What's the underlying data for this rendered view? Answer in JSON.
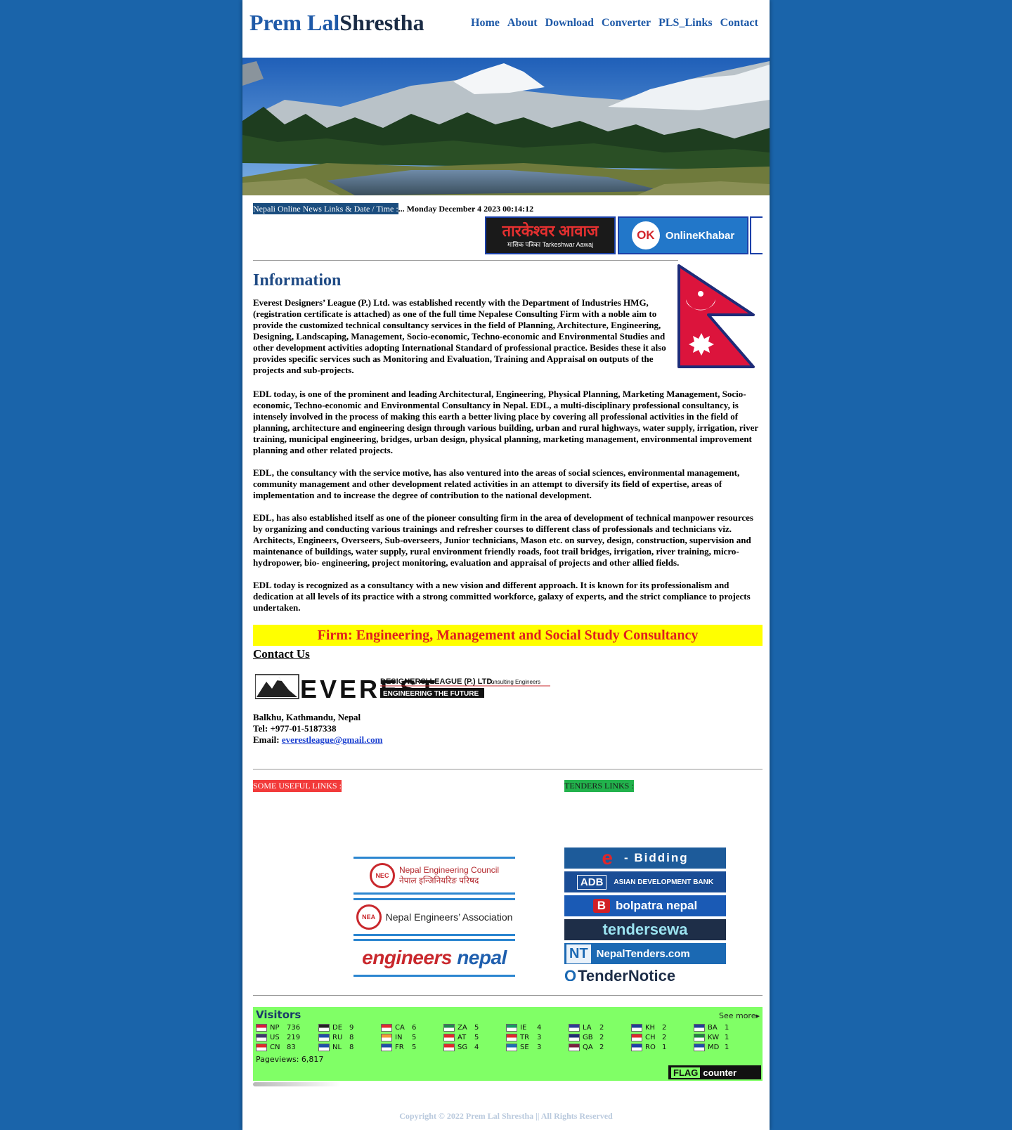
{
  "header": {
    "brand_first": "Prem Lal",
    "brand_last": "Shrestha",
    "nav": [
      "Home",
      "About",
      "Download",
      "Converter",
      "PLS_Links",
      "Contact"
    ]
  },
  "ticker": {
    "label": "Nepali Online News Links & Date / Time :",
    "datetime": "... Monday December 4 2023 00:14:12"
  },
  "news_links": [
    {
      "title": "तारकेश्वर आवाज",
      "subtitle": "मासिक पत्रिका  Tarkeshwar Aawaj"
    },
    {
      "badge": "OK",
      "title": "OnlineKhabar"
    }
  ],
  "info": {
    "title": "Information",
    "paragraphs": [
      "Everest Designers’ League (P.) Ltd. was established recently with the Department of Industries HMG, (registration certificate is attached) as one of the full time Nepalese Consulting Firm with a noble aim to provide the customized technical consultancy services in the field of Planning, Architecture, Engineering, Designing, Landscaping, Management, Socio-economic, Techno-economic and Environmental Studies and other development activities adopting International Standard of professional practice. Besides these it also provides specific services such as Monitoring and Evaluation, Training and Appraisal on outputs of the projects and sub-projects.",
      "EDL today, is one of the prominent and leading Architectural, Engineering, Physical Planning, Marketing Management, Socio-economic, Techno-economic and Environmental Consultancy in Nepal. EDL, a multi-disciplinary professional consultancy, is intensely involved in the process of making this earth a better living place by covering all professional activities in the field of planning, architecture and engineering design through various building, urban and rural highways, water supply, irrigation, river training, municipal engineering, bridges, urban design, physical planning, marketing management, environmental improvement planning and other related projects.",
      "EDL, the consultancy with the service motive, has also ventured into the areas of social sciences, environmental management, community management and other development related activities in an attempt to diversify its field of expertise, areas of implementation and to increase the degree of contribution to the national development.",
      "EDL, has also established itself as one of the pioneer consulting firm in the area of development of technical manpower resources by organizing and conducting various trainings and refresher courses to different class of professionals and technicians viz. Architects, Engineers, Overseers, Sub-overseers, Junior technicians, Mason etc. on survey, design, construction, supervision and maintenance of buildings, water supply, rural environment friendly roads, foot trail bridges, irrigation, river training, micro-hydropower, bio- engineering, project monitoring, evaluation and appraisal of projects and other allied fields.",
      "EDL today is recognized as a consultancy with a new vision and different approach. It is known for its professionalism and dedication at all levels of its practice with a strong committed workforce, galaxy of experts, and the strict compliance to projects undertaken."
    ],
    "firm_banner": "Firm: Engineering, Management and Social Study Consultancy"
  },
  "contact": {
    "title": "Contact Us",
    "logo_word": "EVEREST",
    "logo_sub": "DESIGNERS' LEAGUE (P.) LTD.",
    "logo_tag": "Consulting Engineers",
    "logo_slogan": "ENGINEERING THE FUTURE",
    "address": "Balkhu, Kathmandu, Nepal",
    "tel": "Tel: +977-01-5187338",
    "email_label": "Email: ",
    "email": "everestleague@gmail.com"
  },
  "useful_links": {
    "title": "SOME USEFUL LINKS :",
    "items": [
      {
        "emblem": "NEC",
        "line1": "Nepal Engineering Council",
        "line2": "नेपाल इन्जिनियरिङ परिषद"
      },
      {
        "emblem": "NEA",
        "line1": "Nepal Engineers’ Association"
      },
      {
        "part1": "engineers",
        "part2": " nepal"
      }
    ]
  },
  "tenders": {
    "title": "TENDERS LINKS :",
    "items": [
      {
        "mark": "e",
        "text": "- Bidding"
      },
      {
        "mark": "ADB",
        "text": "ASIAN DEVELOPMENT BANK"
      },
      {
        "mark": "B",
        "text": "bolpatra nepal"
      },
      {
        "text": "tendersewa"
      },
      {
        "mark": "NT",
        "text": "NepalTenders.com"
      },
      {
        "mark": "Q",
        "text": "TenderNotice"
      }
    ]
  },
  "visitors": {
    "title": "Visitors",
    "see_more": "See more▸",
    "pageviews": "Pageviews: 6,817",
    "badge_text": "FLAG",
    "badge_mark": "counter",
    "rows": [
      [
        {
          "code": "NP",
          "count": "736",
          "color": "#d81b3c"
        },
        {
          "code": "DE",
          "count": "9",
          "color": "#222222"
        },
        {
          "code": "CA",
          "count": "6",
          "color": "#e02b2b"
        },
        {
          "code": "ZA",
          "count": "5",
          "color": "#1f8a4c"
        },
        {
          "code": "IE",
          "count": "4",
          "color": "#169b62"
        },
        {
          "code": "LA",
          "count": "2",
          "color": "#2d3c96"
        },
        {
          "code": "KH",
          "count": "2",
          "color": "#1c3f95"
        },
        {
          "code": "BA",
          "count": "1",
          "color": "#1e3f96"
        }
      ],
      [
        {
          "code": "US",
          "count": "219",
          "color": "#3c3b6e"
        },
        {
          "code": "RU",
          "count": "8",
          "color": "#1f4fa8"
        },
        {
          "code": "IN",
          "count": "5",
          "color": "#f29d38"
        },
        {
          "code": "AT",
          "count": "5",
          "color": "#e02b2b"
        },
        {
          "code": "TR",
          "count": "3",
          "color": "#e02b2b"
        },
        {
          "code": "GB",
          "count": "2",
          "color": "#1c2f73"
        },
        {
          "code": "CH",
          "count": "2",
          "color": "#e02b2b"
        },
        {
          "code": "KW",
          "count": "1",
          "color": "#1a8a3b"
        }
      ],
      [
        {
          "code": "CN",
          "count": "83",
          "color": "#e02b2b"
        },
        {
          "code": "NL",
          "count": "8",
          "color": "#1f4fa8"
        },
        {
          "code": "FR",
          "count": "5",
          "color": "#1f4fa8"
        },
        {
          "code": "SG",
          "count": "4",
          "color": "#e02b2b"
        },
        {
          "code": "SE",
          "count": "3",
          "color": "#1f6fb3"
        },
        {
          "code": "QA",
          "count": "2",
          "color": "#7a1f3d"
        },
        {
          "code": "RO",
          "count": "1",
          "color": "#1f3fa8"
        },
        {
          "code": "MD",
          "count": "1",
          "color": "#1f4fa8"
        }
      ]
    ]
  },
  "footer": {
    "copyright": "Copyright © 2022 Prem Lal Shrestha || All Rights Reserved"
  }
}
